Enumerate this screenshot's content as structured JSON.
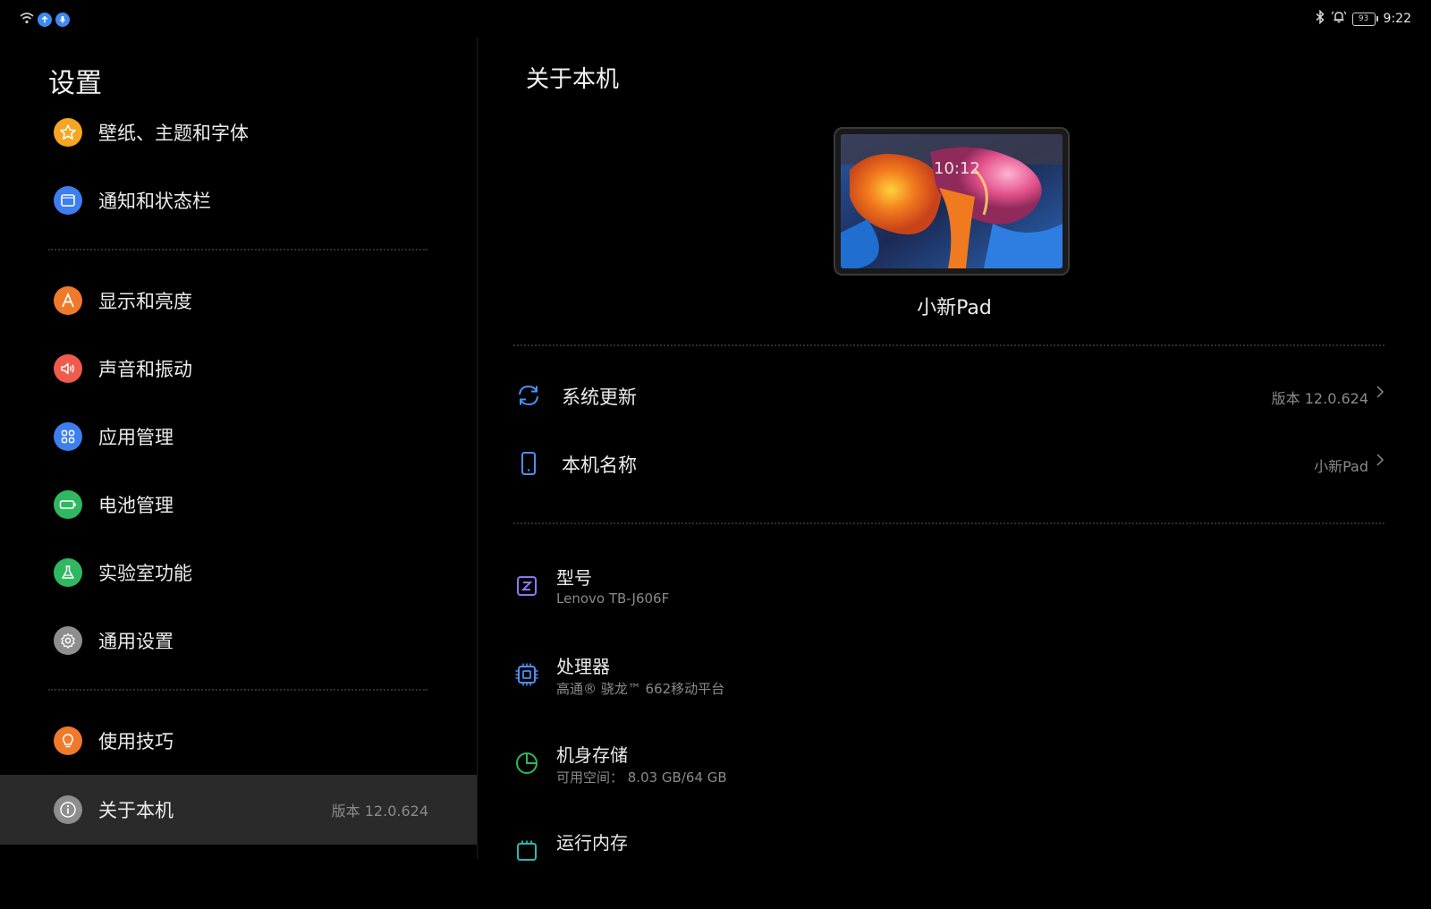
{
  "status_bar": {
    "time": "9:22",
    "battery": "93",
    "icons_left": [
      "wifi-icon",
      "upload-icon",
      "mic-icon"
    ],
    "icons_right": [
      "bluetooth-icon",
      "bell-icon",
      "battery-icon"
    ]
  },
  "left": {
    "title": "设置",
    "items": [
      {
        "label": "壁纸、主题和字体",
        "icon": "star-icon",
        "color": "#f5a623"
      },
      {
        "label": "通知和状态栏",
        "icon": "notification-panel-icon",
        "color": "#3d7ef0"
      },
      {
        "label": "显示和亮度",
        "icon": "display-brightness-icon",
        "color": "#f07a2a"
      },
      {
        "label": "声音和振动",
        "icon": "speaker-icon",
        "color": "#ef5b4c"
      },
      {
        "label": "应用管理",
        "icon": "apps-grid-icon",
        "color": "#3d7ef0"
      },
      {
        "label": "电池管理",
        "icon": "battery-icon",
        "color": "#2fb860"
      },
      {
        "label": "实验室功能",
        "icon": "flask-icon",
        "color": "#2fb860"
      },
      {
        "label": "通用设置",
        "icon": "gear-icon",
        "color": "#8e8e8e"
      },
      {
        "label": "使用技巧",
        "icon": "bulb-icon",
        "color": "#f07a2a"
      },
      {
        "label": "关于本机",
        "icon": "info-icon",
        "color": "#8e8e8e",
        "value": "版本 12.0.624"
      }
    ]
  },
  "right": {
    "title": "关于本机",
    "device_name": "小新Pad",
    "device_preview_time": "10:12",
    "rows": [
      {
        "label": "系统更新",
        "value": "版本 12.0.624",
        "icon": "refresh-icon"
      },
      {
        "label": "本机名称",
        "value": "小新Pad",
        "icon": "tablet-icon"
      }
    ],
    "info": [
      {
        "title": "型号",
        "sub": "Lenovo TB-J606F",
        "icon": "model-icon"
      },
      {
        "title": "处理器",
        "sub": "高通® 骁龙™ 662移动平台",
        "icon": "chip-icon"
      },
      {
        "title": "机身存储",
        "sub": "可用空间：  8.03 GB/64 GB",
        "icon": "storage-pie-icon"
      },
      {
        "title": "运行内存",
        "sub": "",
        "icon": "memory-icon"
      }
    ]
  },
  "colors": {
    "background": "#000000",
    "selected_item": "#2a2a2a",
    "accent_blue": "#3d7ef0",
    "accent_green": "#2fb860"
  }
}
